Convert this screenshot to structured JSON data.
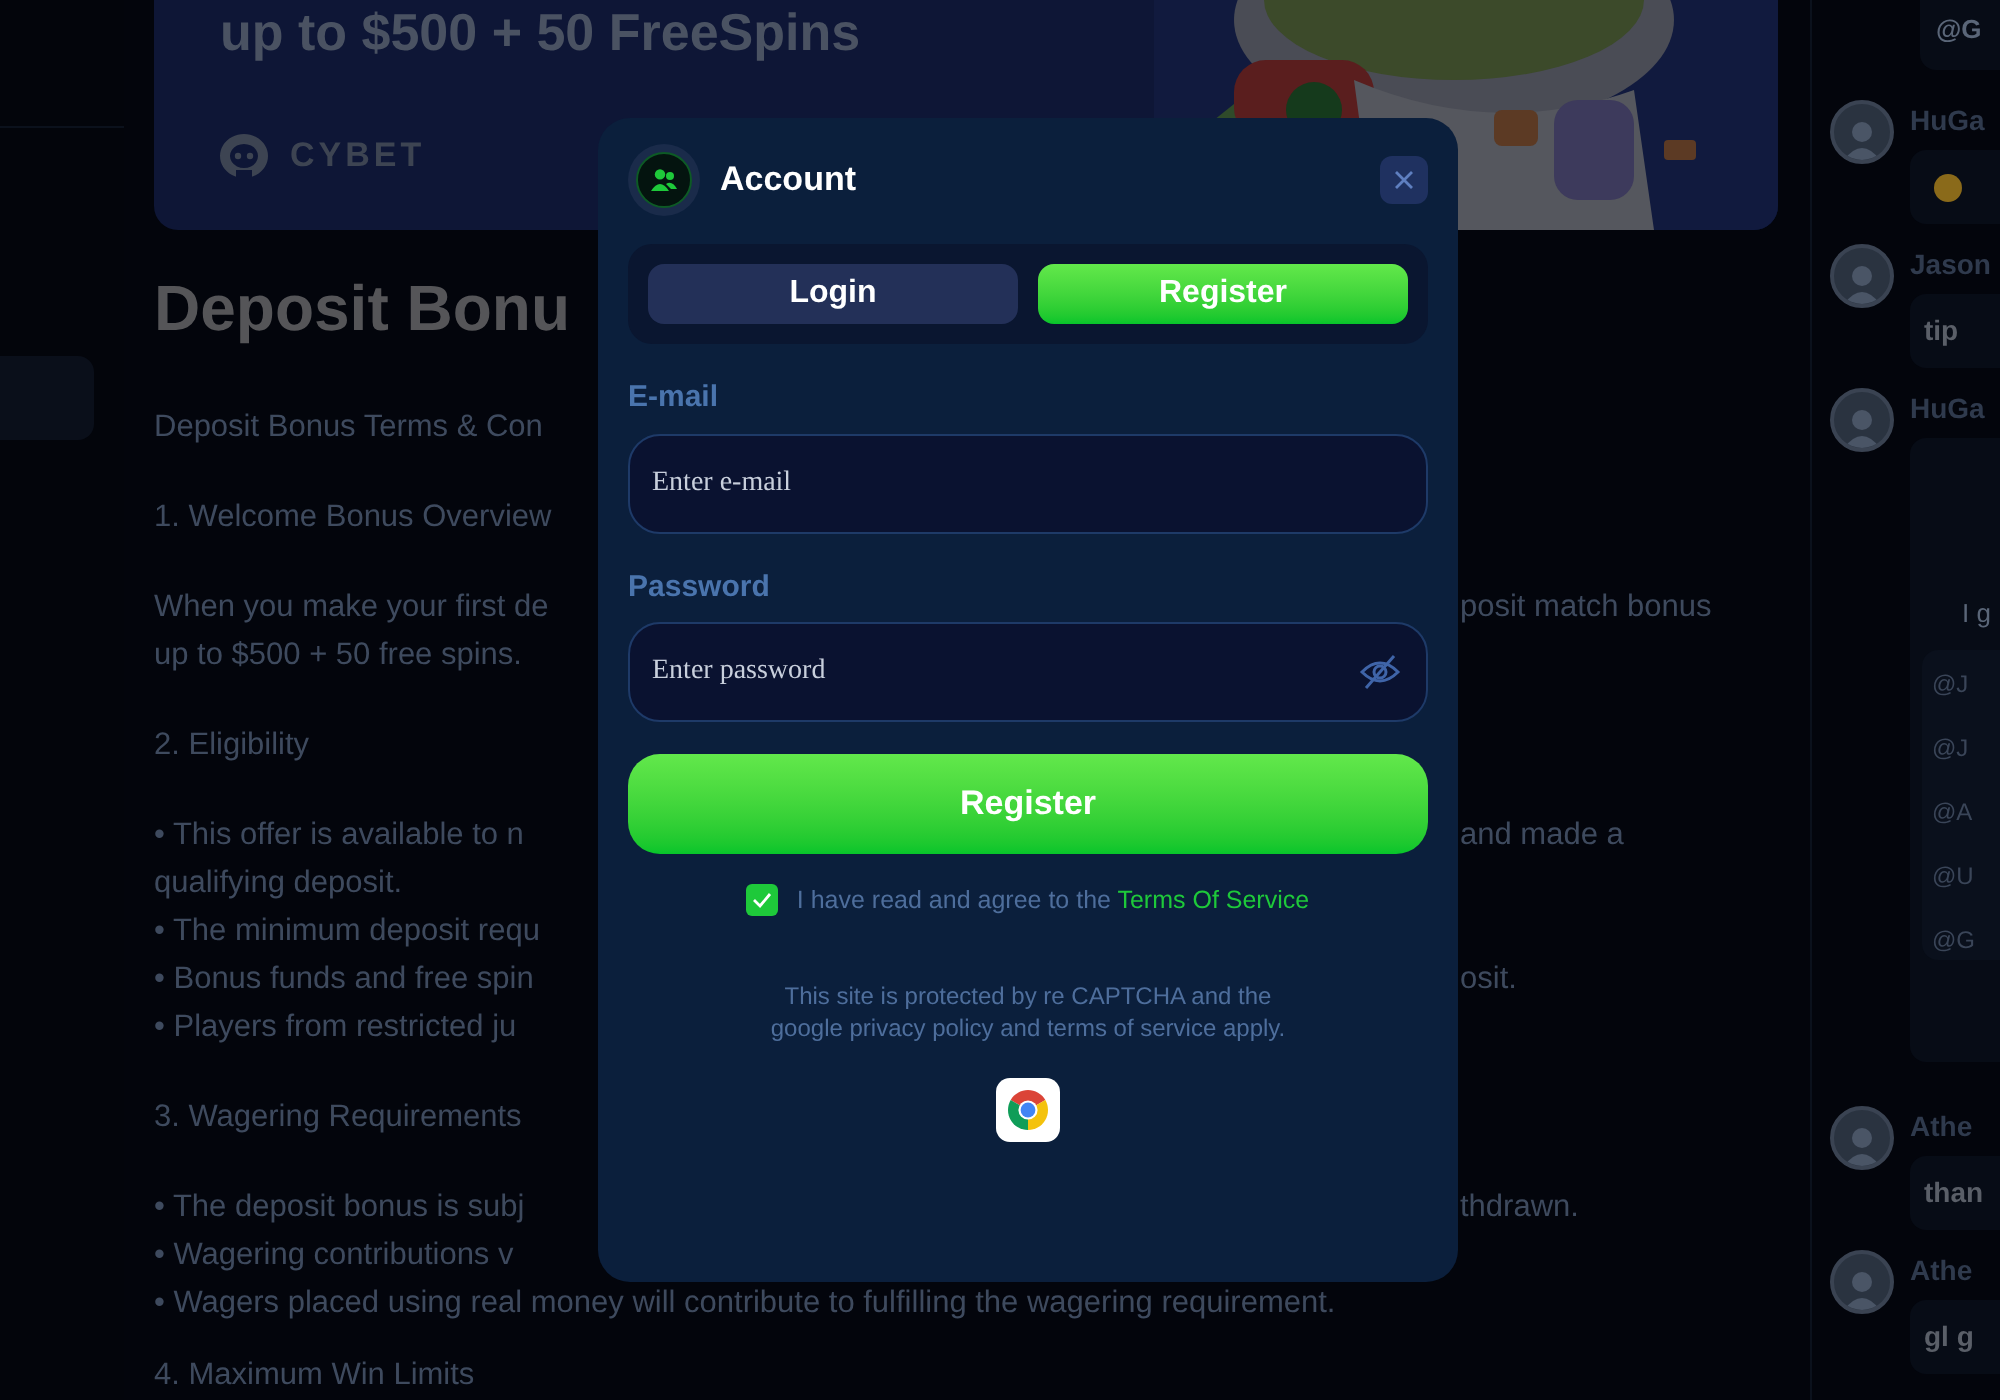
{
  "banner": {
    "headline": "up to $500 + 50 FreeSpins",
    "brand": "CYBET"
  },
  "article": {
    "title": "Deposit Bonu",
    "paragraphs": [
      [
        {
          "left": "Deposit Bonus Terms & Con"
        }
      ],
      [
        {
          "left": "1. Welcome Bonus Overview"
        }
      ],
      [
        {
          "left": "When you make your first de",
          "right": "posit match bonus"
        },
        {
          "left": "up to $500 + 50 free spins."
        }
      ],
      [
        {
          "left": "2. Eligibility"
        }
      ],
      [
        {
          "left": "• This offer is available to n",
          "right": "and made a"
        },
        {
          "left": "qualifying deposit."
        },
        {
          "left": "• The minimum deposit requ"
        },
        {
          "left": "• Bonus funds and free spin",
          "right": "osit."
        },
        {
          "left": "• Players from restricted ju"
        }
      ],
      [
        {
          "left": "3. Wagering Requirements"
        }
      ],
      [
        {
          "left": "• The deposit bonus is subj",
          "right": "thdrawn."
        },
        {
          "left": "• Wagering contributions v"
        },
        {
          "left": "• Wagers placed using real money will contribute to fulfilling the wagering requirement."
        }
      ],
      [
        {
          "left": "4. Maximum Win Limits"
        }
      ]
    ]
  },
  "modal": {
    "title": "Account",
    "tabs": [
      {
        "label": "Login",
        "selected": false
      },
      {
        "label": "Register",
        "selected": true
      }
    ],
    "fields": [
      {
        "label": "E-mail",
        "placeholder": "Enter e-mail",
        "kind": "text"
      },
      {
        "label": "Password",
        "placeholder": "Enter password",
        "kind": "password"
      }
    ],
    "submit": "Register",
    "agree": {
      "checked": true,
      "text": "I have read and agree to the ",
      "link": "Terms Of Service"
    },
    "notice_lines": [
      "This site is protected by re CAPTCHA and the",
      "google privacy policy and terms of service apply."
    ]
  },
  "chat": {
    "top_mention": "@G",
    "messages": [
      {
        "name": "HuGa",
        "kind": "emoji"
      },
      {
        "name": "Jason",
        "kind": "text",
        "text": "tip"
      },
      {
        "name": "HuGa",
        "kind": "quote",
        "text": "I g",
        "mentions": [
          "@J",
          "@J",
          "@A",
          "@U",
          "@G"
        ]
      },
      {
        "name": "Athe",
        "kind": "text",
        "text": "than"
      },
      {
        "name": "Athe",
        "kind": "text",
        "text": "gl g"
      }
    ]
  }
}
